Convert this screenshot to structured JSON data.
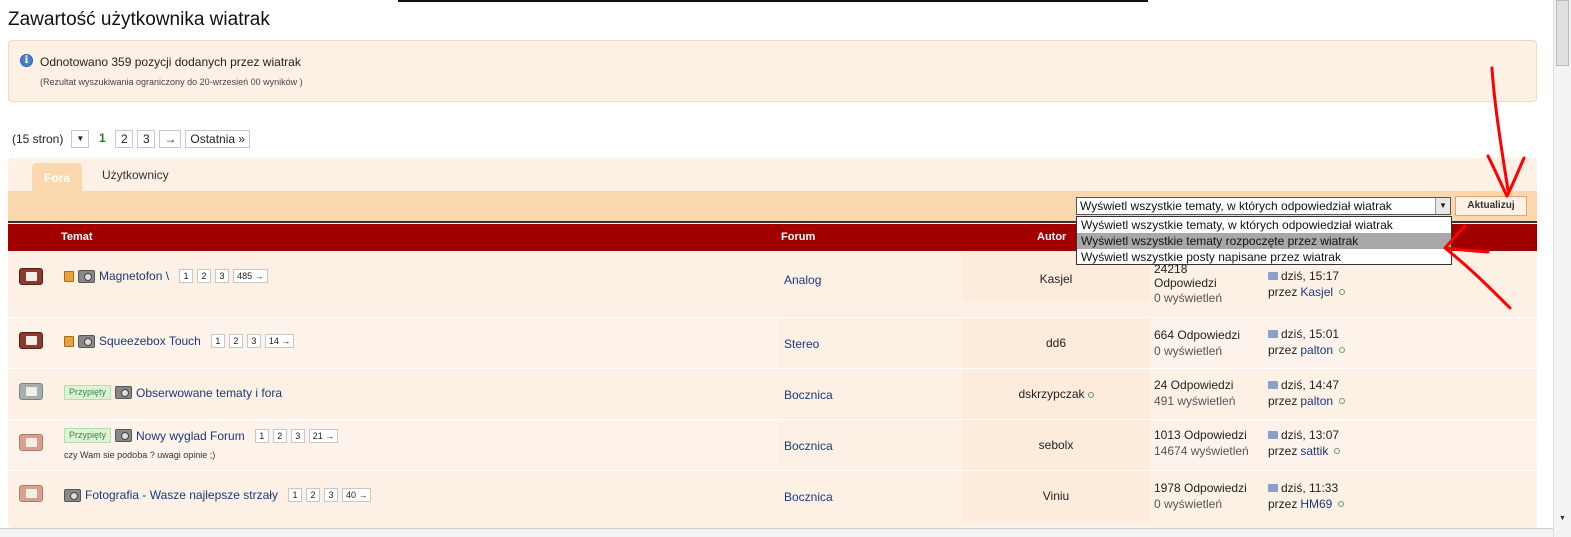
{
  "page": {
    "title": "Zawartość użytkownika wiatrak"
  },
  "message": {
    "main": "Odnotowano 359 pozycji dodanych przez wiatrak",
    "sub": "(Rezultat wyszukiwania ograniczony do 20-wrzesień 00 wyników )",
    "icon": "info-icon"
  },
  "pagination": {
    "pages_count": "(15 stron)",
    "dropdown_arrow": "▼",
    "current": "1",
    "pages": [
      "2",
      "3"
    ],
    "next": "→",
    "last": "Ostatnia »"
  },
  "tabs": {
    "active": "Fora",
    "inactive": "Użytkownicy"
  },
  "filter": {
    "selected": "Wyświetl wszystkie tematy, w których odpowiedział wiatrak",
    "options": [
      "Wyświetl wszystkie tematy, w których odpowiedział wiatrak",
      "Wyświetl wszystkie tematy rozpoczęte przez wiatrak",
      "Wyświetl wszystkie posty napisane przez wiatrak"
    ],
    "highlighted_index": 1,
    "update_label": "Aktualizuj"
  },
  "table": {
    "headers": {
      "topic": "Temat",
      "forum": "Forum",
      "author": "Autor"
    },
    "rows": [
      {
        "status": "hot",
        "pinned": "",
        "title": "Magnetofon \\",
        "pages": [
          "1",
          "2",
          "3",
          "485 →"
        ],
        "desc": "",
        "forum": "Analog",
        "author": "Kasjel",
        "replies": "24218",
        "replies2": "Odpowiedzi",
        "views": "0 wyświetleń",
        "last_time": "dziś, 15:17",
        "last_by": "przez",
        "last_user": "Kasjel"
      },
      {
        "status": "hot",
        "pinned": "",
        "title": "Squeezebox Touch",
        "pages": [
          "1",
          "2",
          "3",
          "14 →"
        ],
        "desc": "",
        "forum": "Stereo",
        "author": "dd6",
        "replies": "664 Odpowiedzi",
        "replies2": "",
        "views": "0 wyświetleń",
        "last_time": "dziś, 15:01",
        "last_by": "przez",
        "last_user": "palton"
      },
      {
        "status": "gray",
        "pinned": "Przypięty",
        "title": "Obserwowane tematy i fora",
        "pages": [],
        "desc": "",
        "forum": "Bocznica",
        "author": "dskrzypczak",
        "replies": "24 Odpowiedzi",
        "replies2": "",
        "views": "491 wyświetleń",
        "last_time": "dziś, 14:47",
        "last_by": "przez",
        "last_user": "palton"
      },
      {
        "status": "pink",
        "pinned": "Przypięty",
        "title": "Nowy wyglad Forum",
        "pages": [
          "1",
          "2",
          "3",
          "21 →"
        ],
        "desc": "czy Wam sie podoba ? uwagi opinie ;)",
        "forum": "Bocznica",
        "author": "sebolx",
        "replies": "1013 Odpowiedzi",
        "replies2": "",
        "views": "14674 wyświetleń",
        "last_time": "dziś, 13:07",
        "last_by": "przez",
        "last_user": "sattik"
      },
      {
        "status": "pink",
        "pinned": "",
        "title": "Fotografia - Wasze najlepsze strzały",
        "pages": [
          "1",
          "2",
          "3",
          "40 →"
        ],
        "desc": "",
        "forum": "Bocznica",
        "author": "Viniu",
        "replies": "1978 Odpowiedzi",
        "replies2": "",
        "views": "0 wyświetleń",
        "last_time": "dziś, 11:33",
        "last_by": "przez",
        "last_user": "HM69"
      }
    ]
  },
  "colors": {
    "header_red": "#a20000",
    "panel_bg": "#fdf1e6",
    "tab_bar": "#fbd7ae",
    "annotation_red": "#ff0000"
  }
}
